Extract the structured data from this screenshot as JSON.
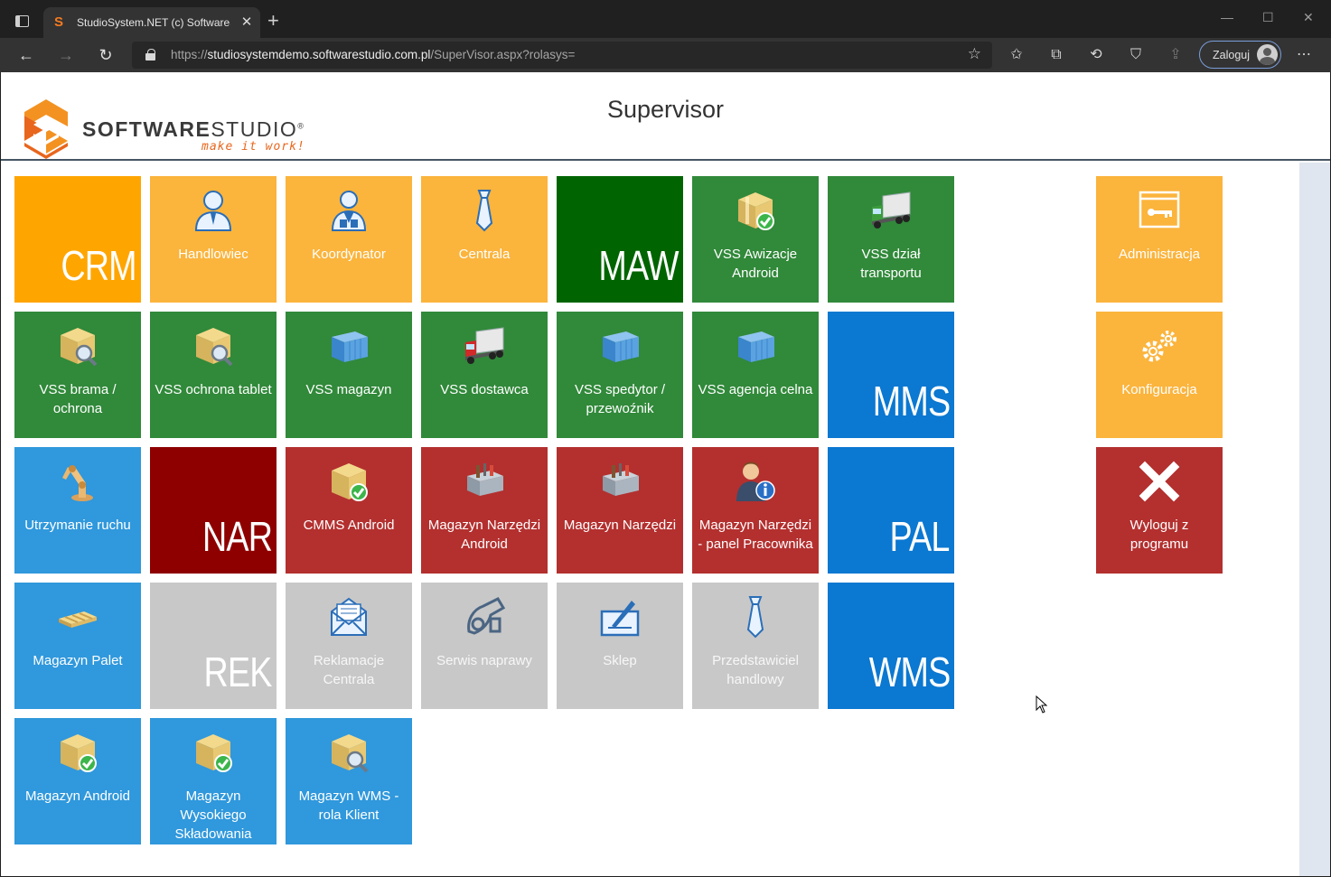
{
  "browser": {
    "tab_title": "StudioSystem.NET (c) SoftwareSt",
    "tab_close": "✕",
    "new_tab": "+",
    "url_prefix": "https://",
    "url_host": "studiosystemdemo.softwarestudio.com.pl",
    "url_path": "/SuperVisor.aspx?rolasys=",
    "login_label": "Zaloguj"
  },
  "header": {
    "brand_bold": "SOFTWARE",
    "brand_light": "STUDIO",
    "brand_reg": "®",
    "tagline": "make it work!",
    "title": "Supervisor"
  },
  "tiles": [
    {
      "big": "CRM",
      "color": "#ffa500"
    },
    {
      "label": "Handlowiec",
      "icon": "businessman-icon",
      "color": "#fbb43c"
    },
    {
      "label": "Koordynator",
      "icon": "coordinator-icon",
      "color": "#fbb43c"
    },
    {
      "label": "Centrala",
      "icon": "tie-icon",
      "color": "#fbb43c"
    },
    {
      "big": "MAW",
      "color": "#006400"
    },
    {
      "label": "VSS Awizacje Android",
      "icon": "box-check-icon",
      "color": "#31893a"
    },
    {
      "label": "VSS dział transportu",
      "icon": "truck-icon",
      "color": "#31893a"
    },
    {
      "label": "Administracja",
      "icon": "admin-window-key-icon",
      "color": "#fbb43c"
    },
    {
      "label": "VSS brama / ochrona",
      "icon": "box-search-icon",
      "color": "#31893a"
    },
    {
      "label": "VSS ochrona tablet",
      "icon": "box-search-icon",
      "color": "#31893a"
    },
    {
      "label": "VSS magazyn",
      "icon": "container-icon",
      "color": "#31893a"
    },
    {
      "label": "VSS dostawca",
      "icon": "truck-icon",
      "color": "#31893a"
    },
    {
      "label": "VSS spedytor / przewoźnik",
      "icon": "container-icon",
      "color": "#31893a"
    },
    {
      "label": "VSS agencja celna",
      "icon": "container-icon",
      "color": "#31893a"
    },
    {
      "big": "MMS",
      "color": "#0b78d1"
    },
    {
      "label": "Konfiguracja",
      "icon": "gears-icon",
      "color": "#fbb43c"
    },
    {
      "label": "Utrzymanie ruchu",
      "icon": "robot-arm-icon",
      "color": "#3098dc"
    },
    {
      "big": "NAR",
      "color": "#8e0000"
    },
    {
      "label": "CMMS Android",
      "icon": "box-check-icon",
      "color": "#b3302f"
    },
    {
      "label": "Magazyn Narzędzi Android",
      "icon": "toolbox-icon",
      "color": "#b3302f"
    },
    {
      "label": "Magazyn Narzędzi",
      "icon": "toolbox-icon",
      "color": "#b3302f"
    },
    {
      "label": "Magazyn Narzędzi - panel Pracownika",
      "icon": "user-info-icon",
      "color": "#b3302f"
    },
    {
      "big": "PAL",
      "color": "#0b78d1"
    },
    {
      "label": "Wyloguj z programu",
      "icon": "close-x-icon",
      "color": "#b3302f"
    },
    {
      "label": "Magazyn Palet",
      "icon": "pallet-icon",
      "color": "#3098dc"
    },
    {
      "big": "REK",
      "color": "#c8c8c8"
    },
    {
      "label": "Reklamacje Centrala",
      "icon": "envelope-icon",
      "color": "#c8c8c8"
    },
    {
      "label": "Serwis naprawy",
      "icon": "service-icon",
      "color": "#c8c8c8"
    },
    {
      "label": "Sklep",
      "icon": "shop-sign-icon",
      "color": "#c8c8c8"
    },
    {
      "label": "Przedstawiciel handlowy",
      "icon": "tie-icon",
      "color": "#c8c8c8"
    },
    {
      "big": "WMS",
      "color": "#0b78d1"
    },
    {
      "label": "Magazyn Android",
      "icon": "box-check-icon",
      "color": "#3098dc"
    },
    {
      "label": "Magazyn Wysokiego Składowania",
      "icon": "box-check-icon",
      "color": "#3098dc"
    },
    {
      "label": "Magazyn WMS - rola Klient",
      "icon": "box-search-icon",
      "color": "#3098dc"
    }
  ]
}
